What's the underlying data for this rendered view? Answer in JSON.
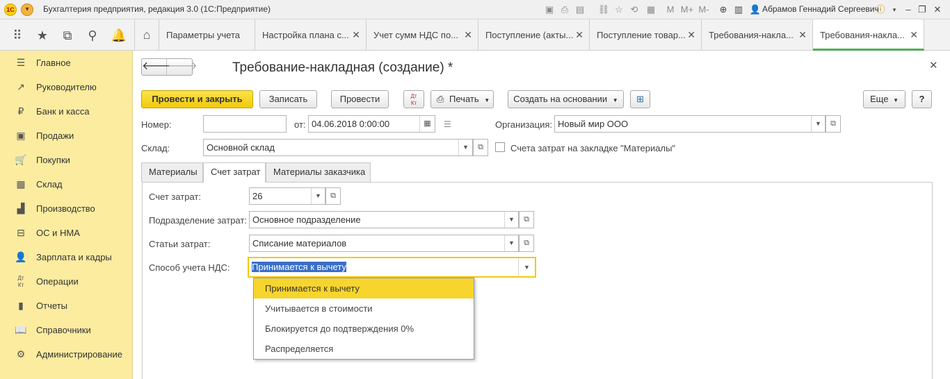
{
  "titlebar": {
    "logo": "1С",
    "app_title": "Бухгалтерия предприятия, редакция 3.0  (1С:Предприятие)",
    "user": "Абрамов Геннадий Сергеевич"
  },
  "tabs": [
    {
      "label": "Параметры учета"
    },
    {
      "label": "Настройка плана с..."
    },
    {
      "label": "Учет сумм НДС по..."
    },
    {
      "label": "Поступление (акты..."
    },
    {
      "label": "Поступление товар..."
    },
    {
      "label": "Требования-накла..."
    },
    {
      "label": "Требования-накла..."
    }
  ],
  "sidebar": {
    "items": [
      {
        "label": "Главное"
      },
      {
        "label": "Руководителю"
      },
      {
        "label": "Банк и касса"
      },
      {
        "label": "Продажи"
      },
      {
        "label": "Покупки"
      },
      {
        "label": "Склад"
      },
      {
        "label": "Производство"
      },
      {
        "label": "ОС и НМА"
      },
      {
        "label": "Зарплата и кадры"
      },
      {
        "label": "Операции"
      },
      {
        "label": "Отчеты"
      },
      {
        "label": "Справочники"
      },
      {
        "label": "Администрирование"
      }
    ]
  },
  "form": {
    "title": "Требование-накладная (создание) *",
    "toolbar": {
      "post_close": "Провести и закрыть",
      "save": "Записать",
      "post": "Провести",
      "dtkt": "Дт\nКт",
      "print": "Печать",
      "create_based": "Создать на основании",
      "more": "Еще",
      "help": "?"
    },
    "number_label": "Номер:",
    "number_value": "",
    "date_label": "от:",
    "date_value": "04.06.2018  0:00:00",
    "org_label": "Организация:",
    "org_value": "Новый мир ООО",
    "warehouse_label": "Склад:",
    "warehouse_value": "Основной склад",
    "checkbox_label": "Счета затрат на закладке \"Материалы\"",
    "checkbox_checked": false,
    "tabs": [
      "Материалы",
      "Счет затрат",
      "Материалы заказчика"
    ],
    "active_tab": 1,
    "cost_account_label": "Счет затрат:",
    "cost_account_value": "26",
    "cost_dept_label": "Подразделение затрат:",
    "cost_dept_value": "Основное подразделение",
    "cost_items_label": "Статьи затрат:",
    "cost_items_value": "Списание материалов",
    "vat_method_label": "Способ учета НДС:",
    "vat_method_value": "Принимается к вычету",
    "vat_options": [
      "Принимается к вычету",
      "Учитывается в стоимости",
      "Блокируется до подтверждения 0%",
      "Распределяется"
    ]
  },
  "colors": {
    "sidebar_bg": "#fbeca0",
    "primary_button": "#f1c90c",
    "selected_option": "#f7d52c",
    "active_tab_underline": "#4caf50"
  }
}
